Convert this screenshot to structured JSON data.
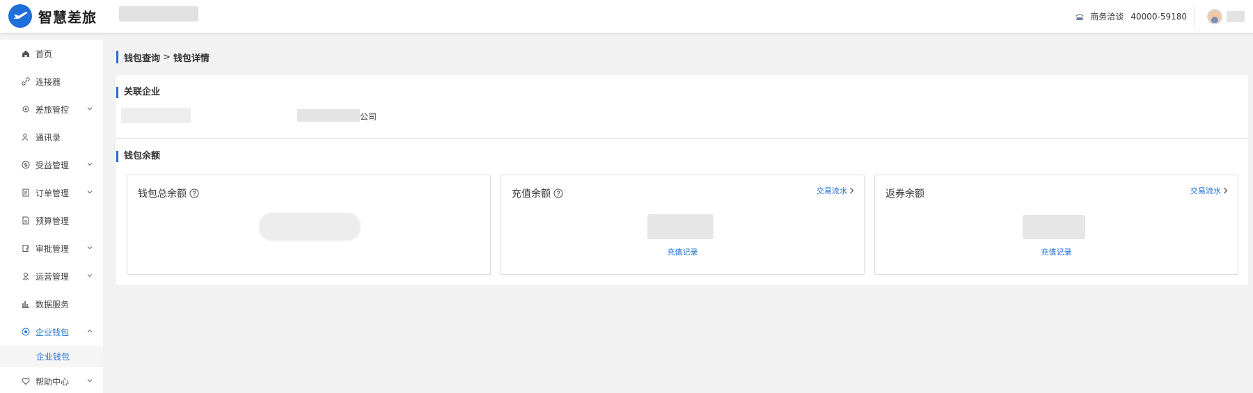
{
  "header": {
    "brand": "智慧差旅",
    "hotline_label": "商务洽谈",
    "hotline_number": "40000-59180"
  },
  "sidebar": {
    "items": [
      {
        "label": "首页",
        "icon": "home-icon",
        "expandable": false
      },
      {
        "label": "连接器",
        "icon": "link-icon",
        "expandable": false
      },
      {
        "label": "差旅管控",
        "icon": "settings-icon",
        "expandable": true
      },
      {
        "label": "通讯录",
        "icon": "contacts-icon",
        "expandable": false
      },
      {
        "label": "受益管理",
        "icon": "dollar-icon",
        "expandable": true
      },
      {
        "label": "订单管理",
        "icon": "order-icon",
        "expandable": true
      },
      {
        "label": "预算管理",
        "icon": "budget-icon",
        "expandable": false
      },
      {
        "label": "审批管理",
        "icon": "approval-icon",
        "expandable": true
      },
      {
        "label": "运营管理",
        "icon": "operations-icon",
        "expandable": true
      },
      {
        "label": "数据服务",
        "icon": "chart-icon",
        "expandable": false
      },
      {
        "label": "企业钱包",
        "icon": "wallet-icon",
        "expandable": true,
        "expanded": true,
        "active": true
      },
      {
        "label": "帮助中心",
        "icon": "heart-icon",
        "expandable": true
      }
    ],
    "sub_item": "企业钱包"
  },
  "breadcrumb": {
    "parent": "钱包查询",
    "separator": ">",
    "current": "钱包详情"
  },
  "company_section": {
    "title": "关联企业",
    "company_suffix": "公司"
  },
  "wallet_section": {
    "title": "钱包余额",
    "cards": [
      {
        "title": "钱包总余额",
        "has_help": true,
        "link": "",
        "sublink": ""
      },
      {
        "title": "充值余额",
        "has_help": true,
        "link": "交易流水",
        "sublink": "充值记录"
      },
      {
        "title": "返券余额",
        "has_help": false,
        "link": "交易流水",
        "sublink": "充值记录"
      }
    ]
  },
  "colors": {
    "accent": "#1e6fd9",
    "background": "#f2f2f2",
    "panel": "#ffffff"
  }
}
